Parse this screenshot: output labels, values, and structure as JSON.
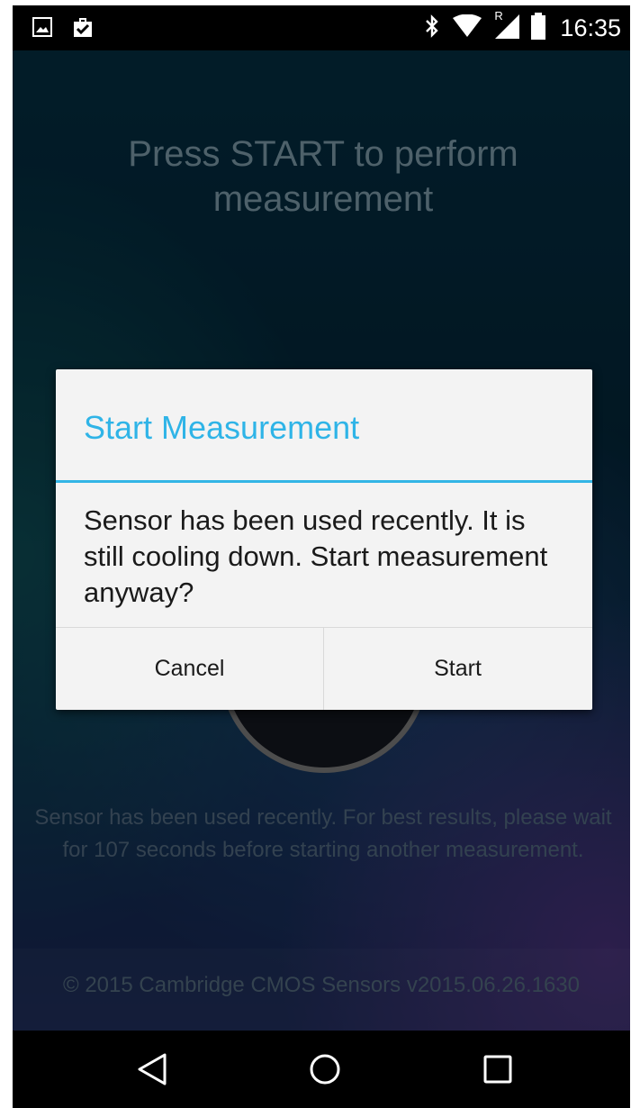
{
  "status_bar": {
    "time": "16:35",
    "left_icons": [
      "image-icon",
      "clipboard-check-icon"
    ],
    "right_icons": [
      "bluetooth-icon",
      "wifi-icon",
      "signal-roaming-icon",
      "battery-icon"
    ],
    "roaming_indicator": "R"
  },
  "app": {
    "title": "Press START to perform measurement",
    "note": "Sensor has been used recently. For best results, please wait for 107 seconds before starting another measurement.",
    "footer": "© 2015 Cambridge CMOS Sensors v2015.06.26.1630"
  },
  "dialog": {
    "title": "Start Measurement",
    "message": "Sensor has been used recently. It is still cooling down. Start measurement anyway?",
    "cancel_label": "Cancel",
    "start_label": "Start",
    "accent_color": "#33b5e5"
  },
  "nav_bar": {
    "icons": [
      "back-icon",
      "home-icon",
      "recent-apps-icon"
    ]
  }
}
